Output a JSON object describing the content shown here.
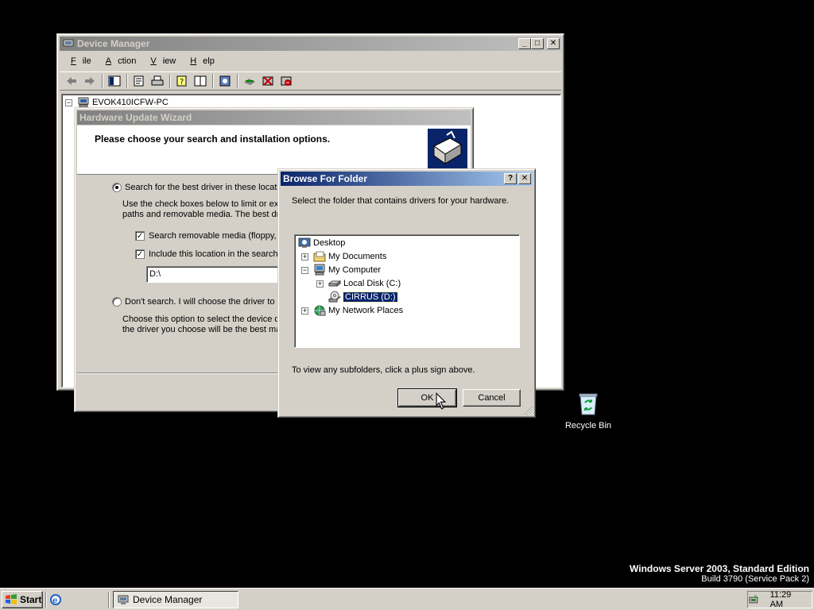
{
  "device_manager": {
    "title": "Device Manager",
    "menu": [
      "File",
      "Action",
      "View",
      "Help"
    ],
    "root_node": "EVOK410ICFW-PC"
  },
  "wizard": {
    "title": "Hardware Update Wizard",
    "header_text": "Please choose your search and installation options.",
    "option_search": "Search for the best driver in these locatio",
    "search_desc_line1": "Use the check boxes below to limit or exp",
    "search_desc_line2": "paths and removable media. The best driv",
    "check_removable": "Search removable media (floppy, C",
    "check_include": "Include this location in the search:",
    "location_value": "D:\\",
    "option_dont": "Don't search. I will choose the driver to in",
    "dont_desc_line1": "Choose this option to select the device dr",
    "dont_desc_line2": "the driver you choose will be the best mat"
  },
  "browse": {
    "title": "Browse For Folder",
    "instruction": "Select the folder that contains drivers for your hardware.",
    "tree": [
      {
        "label": "Desktop",
        "icon": "desktop-icon"
      },
      {
        "label": "My Documents",
        "icon": "folder-icon"
      },
      {
        "label": "My Computer",
        "icon": "computer-icon"
      },
      {
        "label": "Local Disk (C:)",
        "icon": "hard-drive-icon"
      },
      {
        "label": "CIRRUS (D:)",
        "icon": "cd-drive-icon"
      },
      {
        "label": "My Network Places",
        "icon": "network-icon"
      }
    ],
    "hint": "To view any subfolders, click a plus sign above.",
    "ok_label": "OK",
    "cancel_label": "Cancel"
  },
  "desktop": {
    "recycle_bin": "Recycle Bin",
    "watermark_line1": "Windows Server 2003, Standard Edition",
    "watermark_line2": "Build 3790 (Service Pack 2)"
  },
  "taskbar": {
    "start_label": "Start",
    "task_label": "Device Manager",
    "clock": "11:29 AM"
  }
}
